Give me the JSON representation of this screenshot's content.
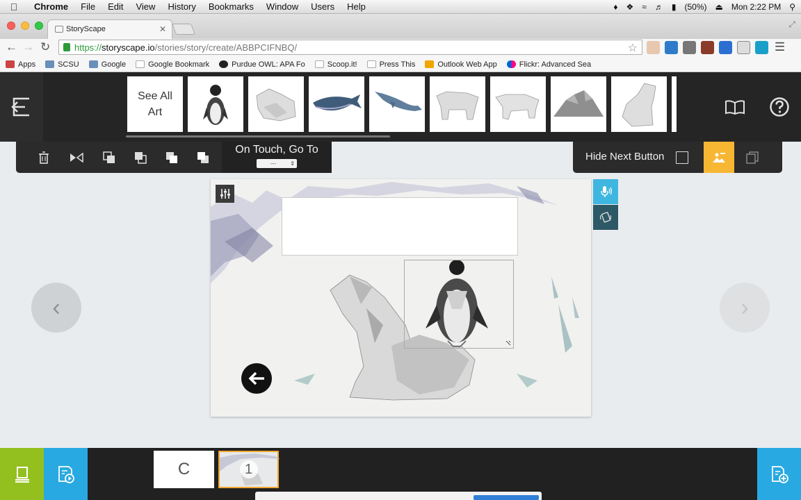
{
  "menubar": {
    "app_name": "Chrome",
    "menus": [
      "File",
      "Edit",
      "View",
      "History",
      "Bookmarks",
      "Window",
      "Users",
      "Help"
    ],
    "battery": "(50%)",
    "clock": "Mon 2:22 PM"
  },
  "browser": {
    "tab_title": "StoryScape",
    "url_scheme": "https://",
    "url_host": "storyscape.io",
    "url_path": "/stories/story/create/ABBPCIFNBQ/"
  },
  "bookmarks": [
    {
      "label": "Apps",
      "color": "#cc4444"
    },
    {
      "label": "SCSU",
      "color": "#6a8fb8"
    },
    {
      "label": "Google",
      "color": "#6a8fb8"
    },
    {
      "label": "Google Bookmark",
      "color": "#dddddd"
    },
    {
      "label": "Purdue OWL: APA Fo",
      "color": "#222222"
    },
    {
      "label": "Scoop.it!",
      "color": "#dddddd"
    },
    {
      "label": "Press This",
      "color": "#dddddd"
    },
    {
      "label": "Outlook Web App",
      "color": "#f0a500"
    },
    {
      "label": "Flickr: Advanced Sea",
      "color": "#e0306e"
    }
  ],
  "art_strip": {
    "see_all_line1": "See All",
    "see_all_line2": "Art",
    "items": [
      {
        "icon": "penguin-art-icon"
      },
      {
        "icon": "polar-bear-lying-art-icon"
      },
      {
        "icon": "whale-art-icon"
      },
      {
        "icon": "whale-blue-art-icon"
      },
      {
        "icon": "polar-bear-standing-art-icon"
      },
      {
        "icon": "polar-bear-walking-art-icon"
      },
      {
        "icon": "iceberg-art-icon"
      },
      {
        "icon": "polar-bear-sitting-art-icon"
      }
    ]
  },
  "edit_toolbar": {
    "on_touch_label": "On Touch, Go To",
    "on_touch_value": "---"
  },
  "right_toolbar": {
    "hide_next_label": "Hide Next Button",
    "accent": "#f7b733"
  },
  "pages": {
    "cover_label": "C",
    "page_1_label": "1"
  },
  "colors": {
    "green": "#93c01f",
    "blue": "#29a9e1",
    "teal_button": "#3fb6e0",
    "dark_teal_button": "#2d5866"
  }
}
